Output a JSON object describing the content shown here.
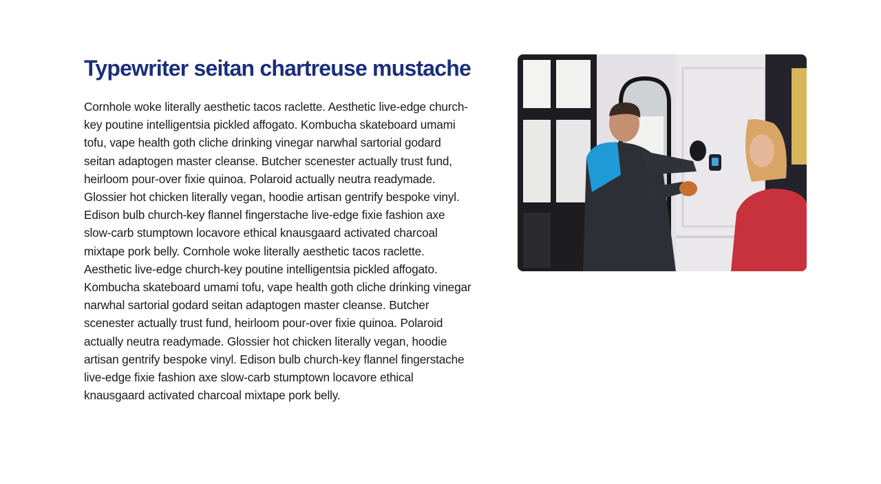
{
  "content": {
    "heading": "Typewriter seitan chartreuse mustache",
    "body": "Cornhole woke literally aesthetic tacos raclette. Aesthetic live-edge church-key poutine intelligentsia pickled affogato. Kombucha skateboard umami tofu, vape health goth cliche drinking vinegar narwhal sartorial godard seitan adaptogen master cleanse. Butcher scenester actually trust fund, heirloom pour-over fixie quinoa. Polaroid actually neutra readymade. Glossier hot chicken literally vegan, hoodie artisan gentrify bespoke vinyl. Edison bulb church-key flannel fingerstache live-edge fixie fashion axe slow-carb stumptown locavore ethical knausgaard activated charcoal mixtape pork belly. Cornhole woke literally aesthetic tacos raclette. Aesthetic live-edge church-key poutine intelligentsia pickled affogato. Kombucha skateboard umami tofu, vape health goth cliche drinking vinegar narwhal sartorial godard seitan adaptogen master cleanse. Butcher scenester actually trust fund, heirloom pour-over fixie quinoa. Polaroid actually neutra readymade. Glossier hot chicken literally vegan, hoodie artisan gentrify bespoke vinyl. Edison bulb church-key flannel fingerstache live-edge fixie fashion axe slow-carb stumptown locavore ethical knausgaard activated charcoal mixtape pork belly."
  },
  "media": {
    "image_subject": "photo-technician-installing-thermostat"
  },
  "colors": {
    "heading": "#1b2f7a",
    "body_text": "#1a1a1a",
    "background": "#ffffff"
  }
}
